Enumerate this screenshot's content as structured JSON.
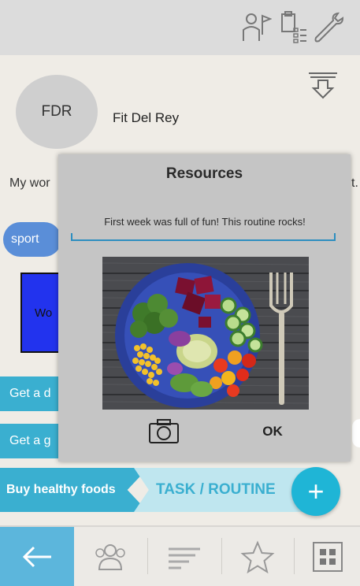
{
  "topbar": {
    "icons": [
      "person-flag-icon",
      "checklist-icon",
      "wrench-icon"
    ]
  },
  "profile": {
    "avatar_text": "FDR",
    "name": "Fit Del Rey"
  },
  "background": {
    "text_left": "My wor",
    "text_right": "t.",
    "sport_label": "sport",
    "workout_label": "Wo",
    "list_items": [
      "Get a d",
      "Get a g"
    ]
  },
  "actions": {
    "buy_label": "Buy healthy foods",
    "task_tab_label": "TASK / ROUTINE",
    "fab_label": "+"
  },
  "bottom_nav": {
    "items": [
      "back-arrow-icon",
      "group-icon",
      "list-lines-icon",
      "star-icon",
      "grid-icon"
    ],
    "active_index": 0
  },
  "modal": {
    "title": "Resources",
    "comment": "First week was full of fun! This routine rocks!",
    "ok_label": "OK"
  },
  "colors": {
    "accent": "#3aafd0",
    "fab": "#1fb5d6",
    "modal_bg": "#c5c5c5",
    "active_nav": "#5cb6dc"
  }
}
